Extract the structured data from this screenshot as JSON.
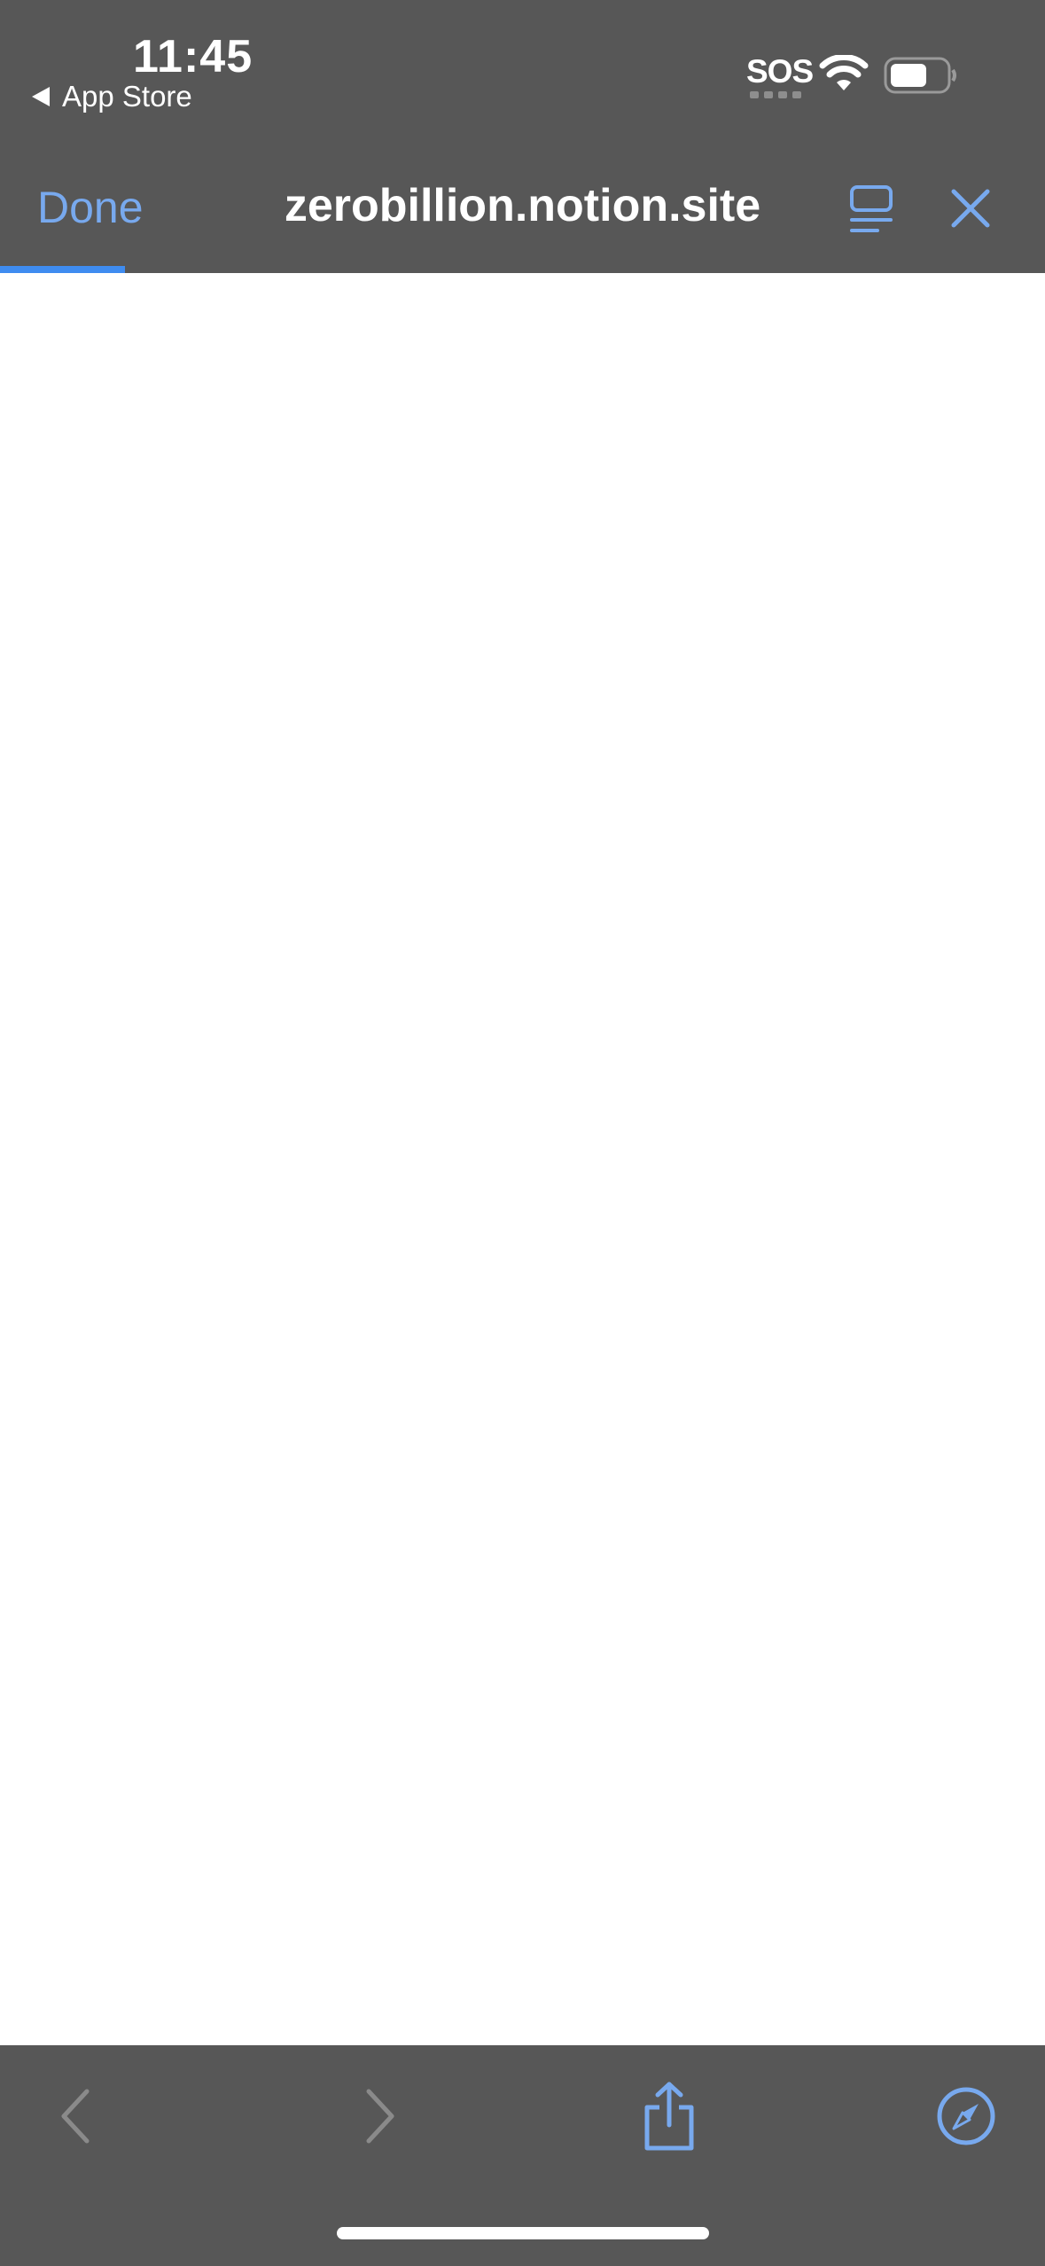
{
  "status_bar": {
    "time": "11:45",
    "back_app": "App Store",
    "sos": "SOS",
    "icons": [
      "wifi-icon",
      "battery-icon"
    ]
  },
  "nav": {
    "done_label": "Done",
    "title": "zerobillion.notion.site",
    "icons": [
      "reader-view-icon",
      "close-icon"
    ],
    "load_progress": 0.12,
    "accent_color": "#78a9ee"
  },
  "toolbar": {
    "icons": [
      "back-arrow-icon",
      "forward-arrow-icon",
      "share-icon",
      "safari-compass-icon"
    ]
  },
  "colors": {
    "bar_background": "#575757",
    "progress": "#3f8cf0"
  }
}
